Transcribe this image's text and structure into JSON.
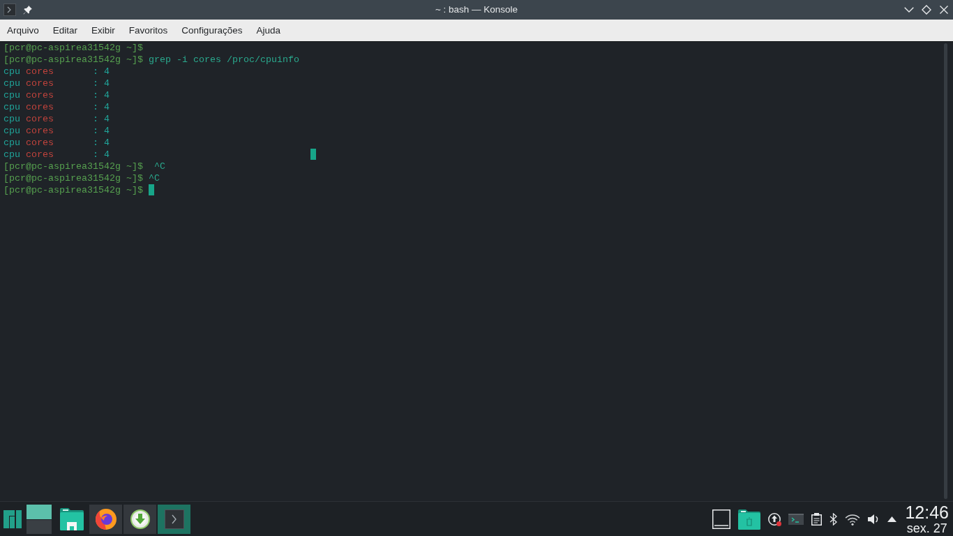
{
  "window": {
    "title": "~ : bash — Konsole"
  },
  "menu_bar": {
    "items": [
      {
        "label": "Arquivo"
      },
      {
        "label": "Editar"
      },
      {
        "label": "Exibir"
      },
      {
        "label": "Favoritos"
      },
      {
        "label": "Configurações"
      },
      {
        "label": "Ajuda"
      }
    ]
  },
  "terminal": {
    "lines": [
      {
        "segments": [
          {
            "kind": "prompt",
            "text": "[pcr@pc-aspirea31542g ~]$"
          }
        ],
        "cursor": false,
        "stray_cursor": false
      },
      {
        "segments": [
          {
            "kind": "prompt",
            "text": "[pcr@pc-aspirea31542g ~]$"
          },
          {
            "kind": "command",
            "text": " grep -i cores /proc/cpuinfo"
          }
        ],
        "cursor": false,
        "stray_cursor": false
      },
      {
        "segments": [
          {
            "kind": "output",
            "text": "cpu "
          },
          {
            "kind": "match",
            "text": "cores"
          },
          {
            "kind": "output",
            "text": "       : 4"
          }
        ],
        "cursor": false,
        "stray_cursor": false
      },
      {
        "segments": [
          {
            "kind": "output",
            "text": "cpu "
          },
          {
            "kind": "match",
            "text": "cores"
          },
          {
            "kind": "output",
            "text": "       : 4"
          }
        ],
        "cursor": false,
        "stray_cursor": false
      },
      {
        "segments": [
          {
            "kind": "output",
            "text": "cpu "
          },
          {
            "kind": "match",
            "text": "cores"
          },
          {
            "kind": "output",
            "text": "       : 4"
          }
        ],
        "cursor": false,
        "stray_cursor": false
      },
      {
        "segments": [
          {
            "kind": "output",
            "text": "cpu "
          },
          {
            "kind": "match",
            "text": "cores"
          },
          {
            "kind": "output",
            "text": "       : 4"
          }
        ],
        "cursor": false,
        "stray_cursor": false
      },
      {
        "segments": [
          {
            "kind": "output",
            "text": "cpu "
          },
          {
            "kind": "match",
            "text": "cores"
          },
          {
            "kind": "output",
            "text": "       : 4"
          }
        ],
        "cursor": false,
        "stray_cursor": false
      },
      {
        "segments": [
          {
            "kind": "output",
            "text": "cpu "
          },
          {
            "kind": "match",
            "text": "cores"
          },
          {
            "kind": "output",
            "text": "       : 4"
          }
        ],
        "cursor": false,
        "stray_cursor": false
      },
      {
        "segments": [
          {
            "kind": "output",
            "text": "cpu "
          },
          {
            "kind": "match",
            "text": "cores"
          },
          {
            "kind": "output",
            "text": "       : 4"
          }
        ],
        "cursor": false,
        "stray_cursor": false
      },
      {
        "segments": [
          {
            "kind": "output",
            "text": "cpu "
          },
          {
            "kind": "match",
            "text": "cores"
          },
          {
            "kind": "output",
            "text": "       : 4"
          }
        ],
        "cursor": false,
        "stray_cursor": true
      },
      {
        "segments": [
          {
            "kind": "prompt",
            "text": "[pcr@pc-aspirea31542g ~]$"
          },
          {
            "kind": "command",
            "text": "  ^C"
          }
        ],
        "cursor": false,
        "stray_cursor": false
      },
      {
        "segments": [
          {
            "kind": "prompt",
            "text": "[pcr@pc-aspirea31542g ~]$"
          },
          {
            "kind": "command",
            "text": " ^C"
          }
        ],
        "cursor": false,
        "stray_cursor": false
      },
      {
        "segments": [
          {
            "kind": "prompt",
            "text": "[pcr@pc-aspirea31542g ~]$"
          }
        ],
        "cursor": true,
        "stray_cursor": false
      }
    ]
  },
  "taskbar": {
    "pager": [
      {
        "selected": true
      },
      {
        "selected": false
      }
    ],
    "tasks": [
      {
        "kind": "browser",
        "active": false
      },
      {
        "kind": "downloader",
        "active": false
      },
      {
        "kind": "terminal",
        "active": true
      }
    ]
  },
  "tray": {
    "update_alert": true,
    "clock": {
      "time": "12:46",
      "date": "sex. 27"
    }
  }
}
